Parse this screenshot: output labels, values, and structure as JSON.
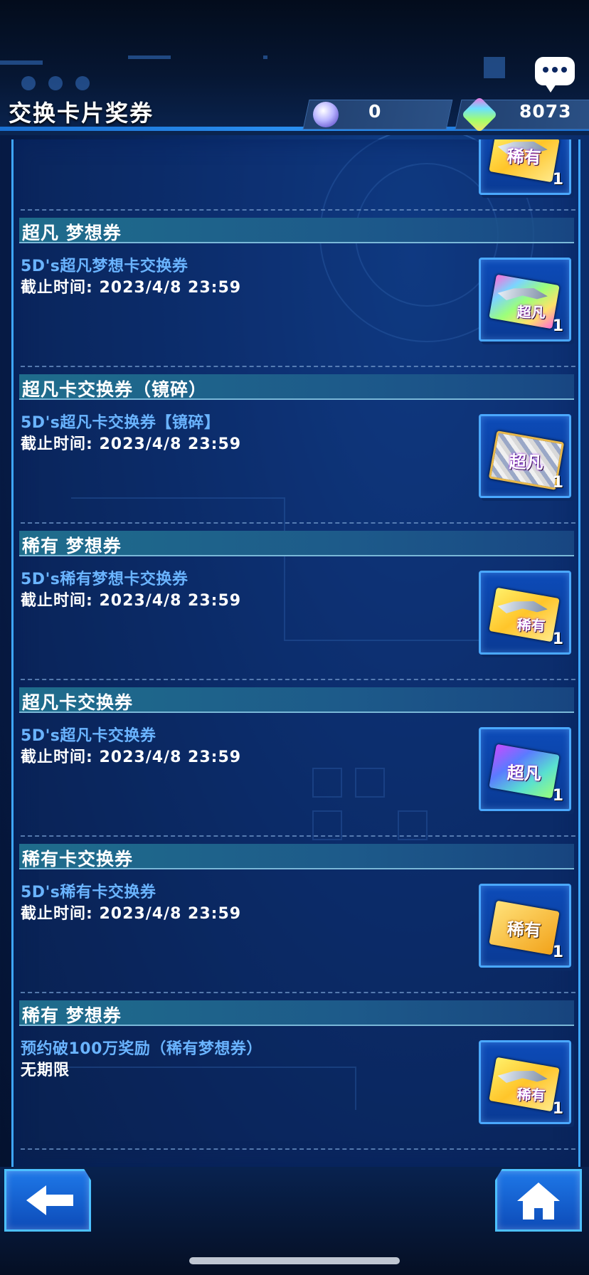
{
  "header": {
    "title": "交换卡片奖券",
    "currency_1": {
      "icon": "orb-icon",
      "value": "0"
    },
    "currency_2": {
      "icon": "crystal-gem-icon",
      "value": "8073"
    }
  },
  "tickets": [
    {
      "section": "超凡 梦想券",
      "name": "5D's超凡梦想卡交换券",
      "deadline": "截止时间: 2023/4/8 23:59",
      "ticket_label": "超凡",
      "count": "1"
    },
    {
      "section": "超凡卡交换券（镜碎）",
      "name": "5D's超凡卡交换券【镜碎】",
      "deadline": "截止时间: 2023/4/8 23:59",
      "ticket_label": "超凡",
      "count": "1"
    },
    {
      "section": "稀有 梦想券",
      "name": "5D's稀有梦想卡交换券",
      "deadline": "截止时间: 2023/4/8 23:59",
      "ticket_label": "稀有",
      "count": "1"
    },
    {
      "section": "超凡卡交换券",
      "name": "5D's超凡卡交换券",
      "deadline": "截止时间: 2023/4/8 23:59",
      "ticket_label": "超凡",
      "count": "1"
    },
    {
      "section": "稀有卡交换券",
      "name": "5D's稀有卡交换券",
      "deadline": "截止时间: 2023/4/8 23:59",
      "ticket_label": "稀有",
      "count": "1"
    },
    {
      "section": "稀有 梦想券",
      "name": "预约破100万奖励（稀有梦想券）",
      "deadline": "无期限",
      "ticket_label": "稀有",
      "count": "1"
    }
  ],
  "partial_top_ticket": {
    "ticket_label": "稀有",
    "count": "1"
  },
  "nav": {
    "back_icon": "arrow-left-icon",
    "home_icon": "home-icon"
  },
  "colors": {
    "accent": "#3ea6ff",
    "item_name": "#6ab4ff",
    "background": "#0a2a66"
  }
}
